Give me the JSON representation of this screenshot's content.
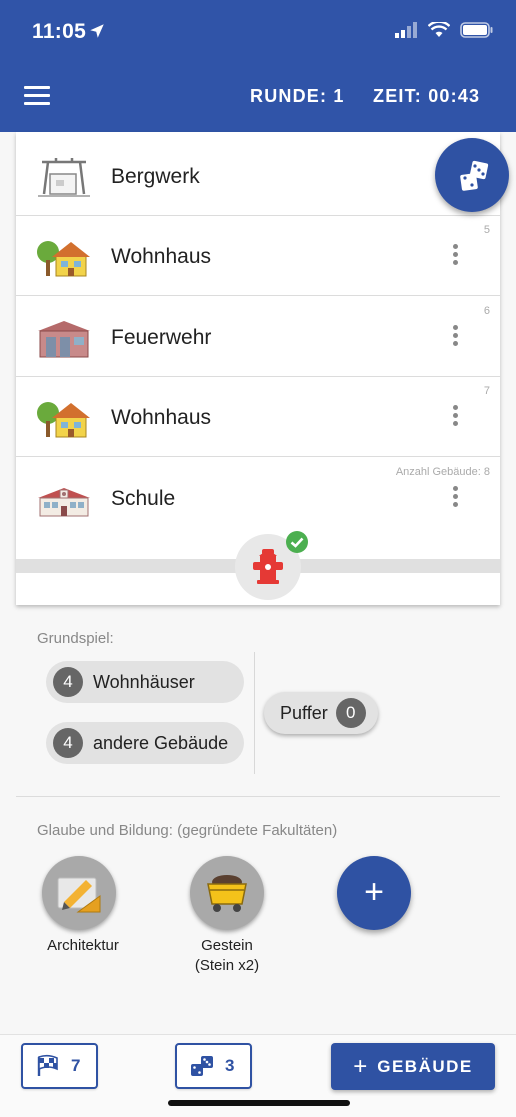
{
  "status_bar": {
    "time": "11:05"
  },
  "toolbar": {
    "round_label": "RUNDE: 1",
    "time_label": "ZEIT: 00:43"
  },
  "buildings": [
    {
      "name": "Bergwerk",
      "number": "",
      "icon": "mine-icon"
    },
    {
      "name": "Wohnhaus",
      "number": "5",
      "icon": "house-icon"
    },
    {
      "name": "Feuerwehr",
      "number": "6",
      "icon": "fire-station-icon"
    },
    {
      "name": "Wohnhaus",
      "number": "7",
      "icon": "house-icon"
    },
    {
      "name": "Schule",
      "number": "Anzahl Gebäude: 8",
      "icon": "school-icon"
    }
  ],
  "grundspiel": {
    "label": "Grundspiel:",
    "wohnhaeuser": {
      "count": "4",
      "label": "Wohnhäuser"
    },
    "andere": {
      "count": "4",
      "label": "andere Gebäude"
    },
    "puffer": {
      "label": "Puffer",
      "count": "0"
    }
  },
  "faculties": {
    "label": "Glaube und Bildung: (gegründete Fakultäten)",
    "items": [
      {
        "line1": "Architektur",
        "line2": ""
      },
      {
        "line1": "Gestein",
        "line2": "(Stein x2)"
      }
    ]
  },
  "bottom": {
    "flag_count": "7",
    "dice_count": "3",
    "add_building_label": "GEBÄUDE"
  },
  "colors": {
    "primary": "#2f52a3",
    "header": "#3054a8",
    "check": "#4caf50",
    "hydrant": "#e53935"
  }
}
